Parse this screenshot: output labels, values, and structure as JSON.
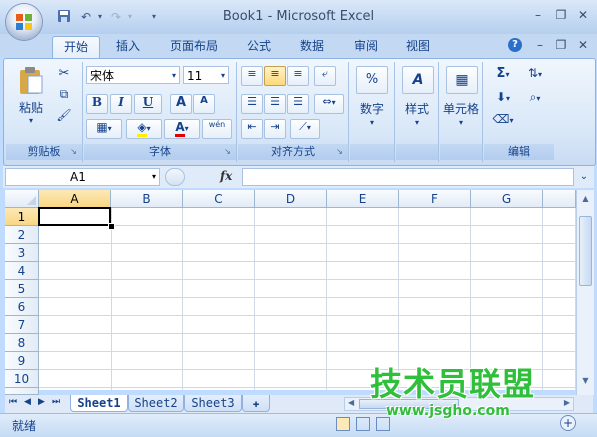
{
  "window": {
    "title": "Book1 - Microsoft Excel"
  },
  "tabs": [
    "开始",
    "插入",
    "页面布局",
    "公式",
    "数据",
    "审阅",
    "视图"
  ],
  "ribbon": {
    "clipboard": {
      "paste_label": "粘贴",
      "group_label": "剪贴板"
    },
    "font": {
      "font_name": "宋体",
      "font_size": "11",
      "group_label": "字体",
      "bold": "B",
      "italic": "I",
      "underline": "U",
      "grow": "A",
      "shrink": "A",
      "font_color_letter": "A",
      "phonetic": "wén"
    },
    "alignment": {
      "group_label": "对齐方式"
    },
    "number": {
      "label": "数字",
      "percent": "%"
    },
    "styles": {
      "label": "样式"
    },
    "cells": {
      "label": "单元格"
    },
    "editing": {
      "group_label": "编辑",
      "sum": "Σ"
    }
  },
  "formula_bar": {
    "name_box": "A1",
    "fx": "fx",
    "formula": ""
  },
  "grid": {
    "columns": [
      "A",
      "B",
      "C",
      "D",
      "E",
      "F",
      "G"
    ],
    "rows": [
      "1",
      "2",
      "3",
      "4",
      "5",
      "6",
      "7",
      "8",
      "9",
      "10"
    ],
    "active_cell": "A1"
  },
  "sheets": [
    "Sheet1",
    "Sheet2",
    "Sheet3"
  ],
  "status": {
    "text": "就绪"
  },
  "watermark": {
    "line1": "技术员联盟",
    "line2": "www.jsgho.com"
  },
  "colors": {
    "ribbon_bg": "#dbe8f8",
    "selection_header": "#f9d682",
    "watermark_green": "#2fbf3a"
  }
}
